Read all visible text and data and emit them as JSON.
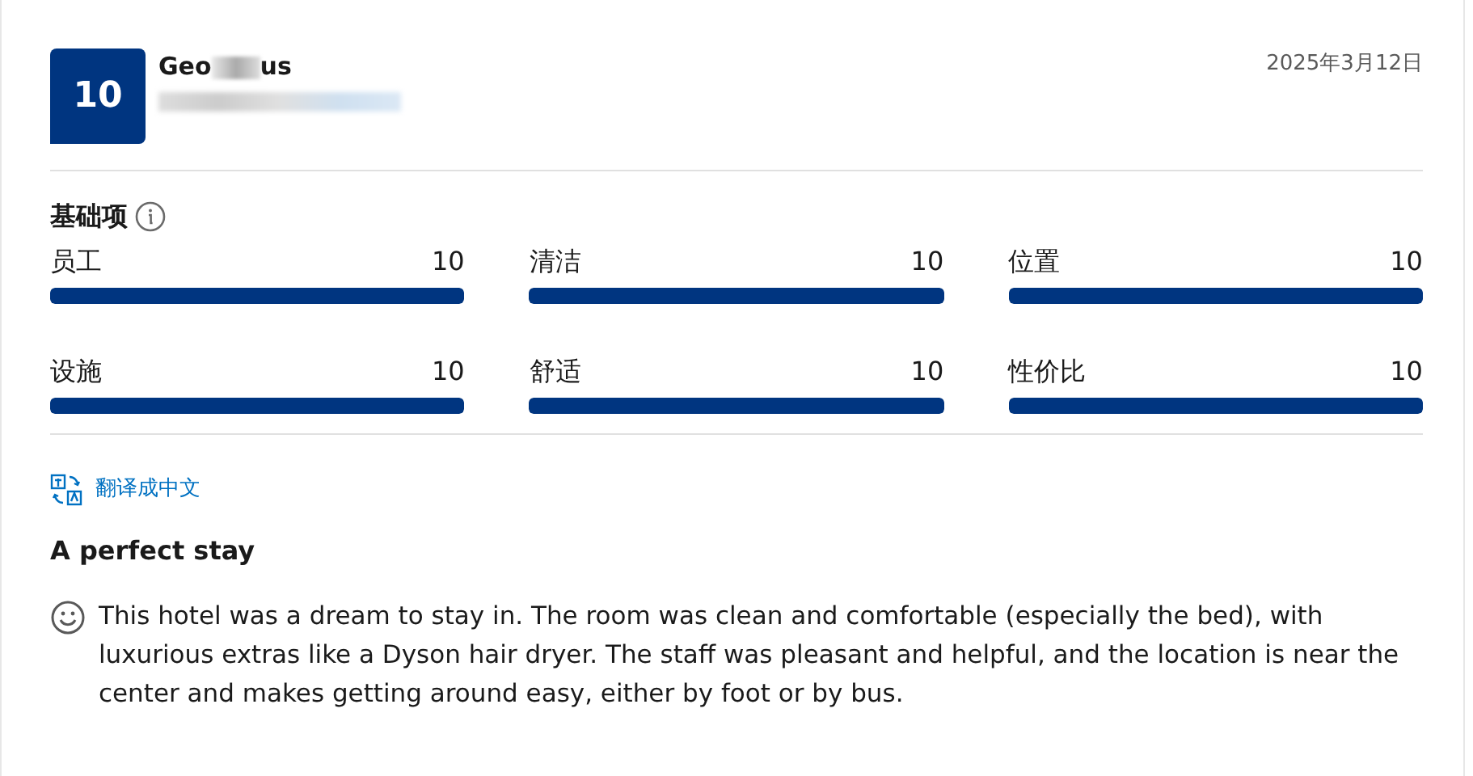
{
  "review": {
    "score": "10",
    "name_start": "Geo",
    "name_end": "us",
    "date": "2025年3月12日"
  },
  "categories_title": "基础项",
  "categories": [
    {
      "label": "员工",
      "value": "10",
      "level": 1
    },
    {
      "label": "清洁",
      "value": "10",
      "level": 1
    },
    {
      "label": "位置",
      "value": "10",
      "level": 1
    },
    {
      "label": "设施",
      "value": "10",
      "level": 1
    },
    {
      "label": "舒适",
      "value": "10",
      "level": 1
    },
    {
      "label": "性价比",
      "value": "10",
      "level": 1
    }
  ],
  "translate_link": "翻译成中文",
  "title": "A perfect stay",
  "text": "This hotel was a dream to stay in. The room was clean and comfortable (especially the bed), with luxurious extras like a Dyson hair dryer. The staff was pleasant and helpful, and the location is near the center and makes getting around easy, either by foot or by bus."
}
